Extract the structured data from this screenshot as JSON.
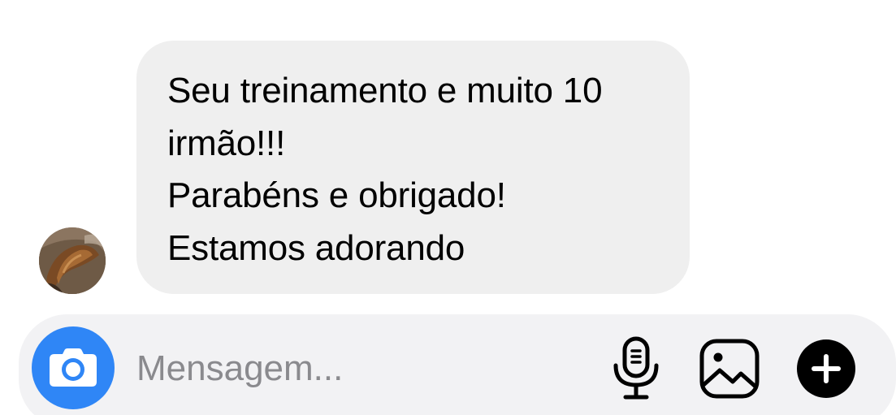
{
  "conversation": {
    "incoming_message": {
      "lines": [
        "Seu treinamento e muito 10",
        "irmão!!!",
        "Parabéns e obrigado!",
        "Estamos adorando"
      ],
      "bubble_color": "#efefef"
    }
  },
  "composer": {
    "placeholder": "Mensagem...",
    "camera_icon": "camera-icon",
    "mic_icon": "microphone-icon",
    "gallery_icon": "image-icon",
    "add_icon": "plus-icon",
    "accent_color": "#2f86f6"
  }
}
